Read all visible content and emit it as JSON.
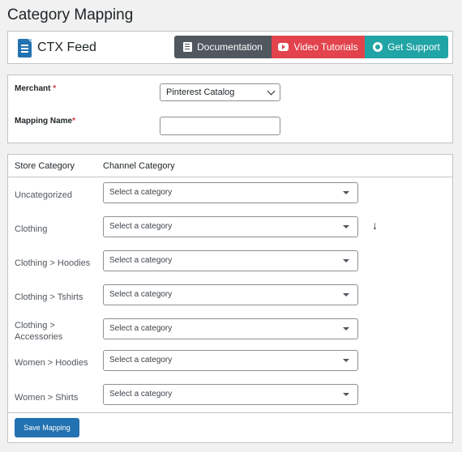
{
  "page": {
    "title": "Category Mapping"
  },
  "header": {
    "brand": "CTX Feed",
    "buttons": {
      "documentation": "Documentation",
      "video": "Video Tutorials",
      "support": "Get Support"
    },
    "colors": {
      "documentation": "#50575e",
      "video": "#e2434c",
      "support": "#20a4a5"
    }
  },
  "form": {
    "merchant_label": "Merchant",
    "merchant_required": "*",
    "merchant_value": "Pinterest Catalog",
    "mapping_name_label": "Mapping Name",
    "mapping_name_required": "*",
    "mapping_name_value": ""
  },
  "mapping": {
    "columns": {
      "store": "Store Category",
      "channel": "Channel Category"
    },
    "select_placeholder": "Select a category",
    "rows": [
      {
        "store_category": "Uncategorized"
      },
      {
        "store_category": "Clothing"
      },
      {
        "store_category": "Clothing > Hoodies"
      },
      {
        "store_category": "Clothing > Tshirts"
      },
      {
        "store_category": "Clothing > Accessories"
      },
      {
        "store_category": "Women > Hoodies"
      },
      {
        "store_category": "Women > Shirts"
      }
    ],
    "copy_down_icon": "arrow-down-icon",
    "copy_down_glyph": "↓",
    "save_label": "Save Mapping",
    "accent": "#2271b1"
  }
}
